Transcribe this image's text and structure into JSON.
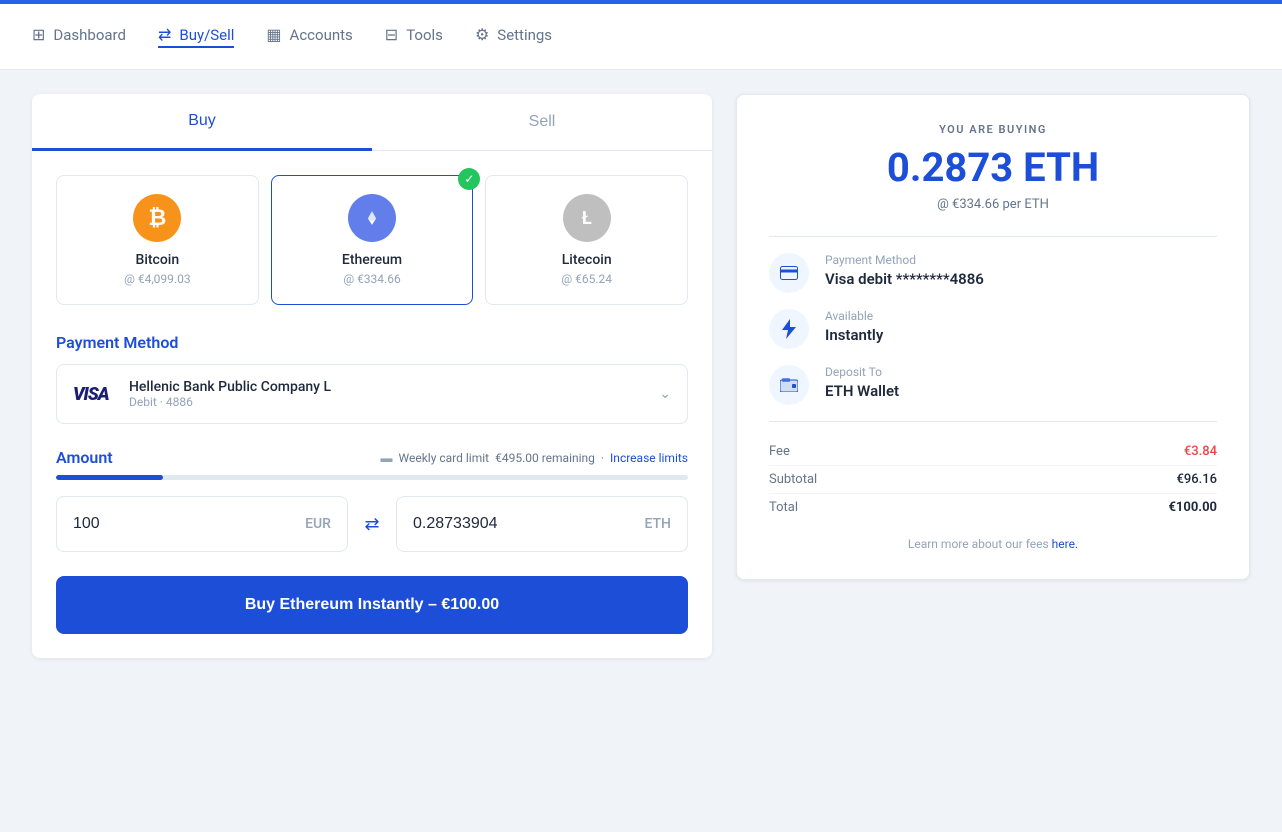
{
  "navbar": {
    "items": [
      {
        "id": "dashboard",
        "label": "Dashboard",
        "icon": "⊞",
        "active": false
      },
      {
        "id": "buysell",
        "label": "Buy/Sell",
        "icon": "⇄",
        "active": true
      },
      {
        "id": "accounts",
        "label": "Accounts",
        "icon": "▦",
        "active": false
      },
      {
        "id": "tools",
        "label": "Tools",
        "icon": "⊟",
        "active": false
      },
      {
        "id": "settings",
        "label": "Settings",
        "icon": "⚙",
        "active": false
      }
    ]
  },
  "tabs": {
    "buy_label": "Buy",
    "sell_label": "Sell",
    "active": "buy"
  },
  "cryptos": [
    {
      "id": "btc",
      "name": "Bitcoin",
      "price": "@ €4,099.03",
      "symbol": "₿",
      "colorClass": "btc-icon",
      "selected": false
    },
    {
      "id": "eth",
      "name": "Ethereum",
      "price": "@ €334.66",
      "symbol": "♦",
      "colorClass": "eth-icon",
      "selected": true
    },
    {
      "id": "ltc",
      "name": "Litecoin",
      "price": "@ €65.24",
      "symbol": "Ł",
      "colorClass": "ltc-icon",
      "selected": false
    }
  ],
  "payment": {
    "section_label": "Payment Method",
    "name": "Hellenic Bank Public Company L",
    "sub": "Debit · 4886",
    "visa_text": "VISA"
  },
  "amount": {
    "section_label": "Amount",
    "limit_label": "Weekly card limit",
    "remaining": "€495.00 remaining",
    "dot": "·",
    "increase_label": "Increase limits",
    "progress_pct": 17,
    "eur_value": "100",
    "eur_currency": "EUR",
    "eth_value": "0.28733904",
    "eth_currency": "ETH"
  },
  "buy_btn": {
    "label": "Buy Ethereum Instantly – €100.00"
  },
  "summary": {
    "you_are_buying": "YOU ARE BUYING",
    "amount": "0.2873 ETH",
    "rate": "@ €334.66 per ETH",
    "payment_label": "Payment Method",
    "payment_value": "Visa debit ********4886",
    "available_label": "Available",
    "available_value": "Instantly",
    "deposit_label": "Deposit To",
    "deposit_value": "ETH Wallet",
    "fee_label": "Fee",
    "fee_value": "€3.84",
    "subtotal_label": "Subtotal",
    "subtotal_value": "€96.16",
    "total_label": "Total",
    "total_value": "€100.00",
    "footer": "Learn more about our fees ",
    "footer_link": "here."
  }
}
